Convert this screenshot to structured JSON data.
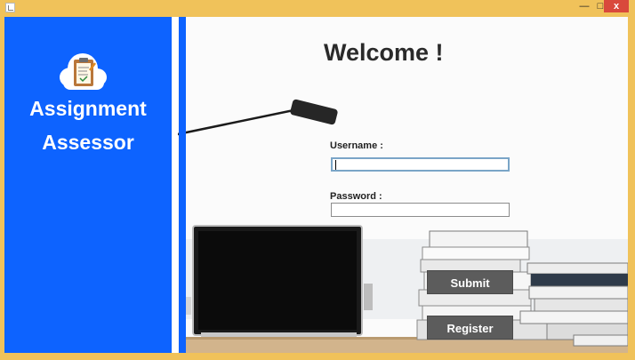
{
  "window": {
    "controls": {
      "minimize": "—",
      "maximize": "□",
      "close": "x"
    }
  },
  "sidebar": {
    "logo_icon": "clipboard-cloud-icon",
    "brand_line1": "Assignment",
    "brand_line2": "Assessor"
  },
  "main": {
    "welcome": "Welcome !",
    "username_label": "Username :",
    "username_value": "",
    "password_label": "Password :",
    "password_value": "",
    "submit_label": "Submit",
    "register_label": "Register"
  },
  "colors": {
    "sidebar_blue": "#0d63ff",
    "window_frame": "#f0c25a",
    "button_gray": "#5c5c5c"
  }
}
